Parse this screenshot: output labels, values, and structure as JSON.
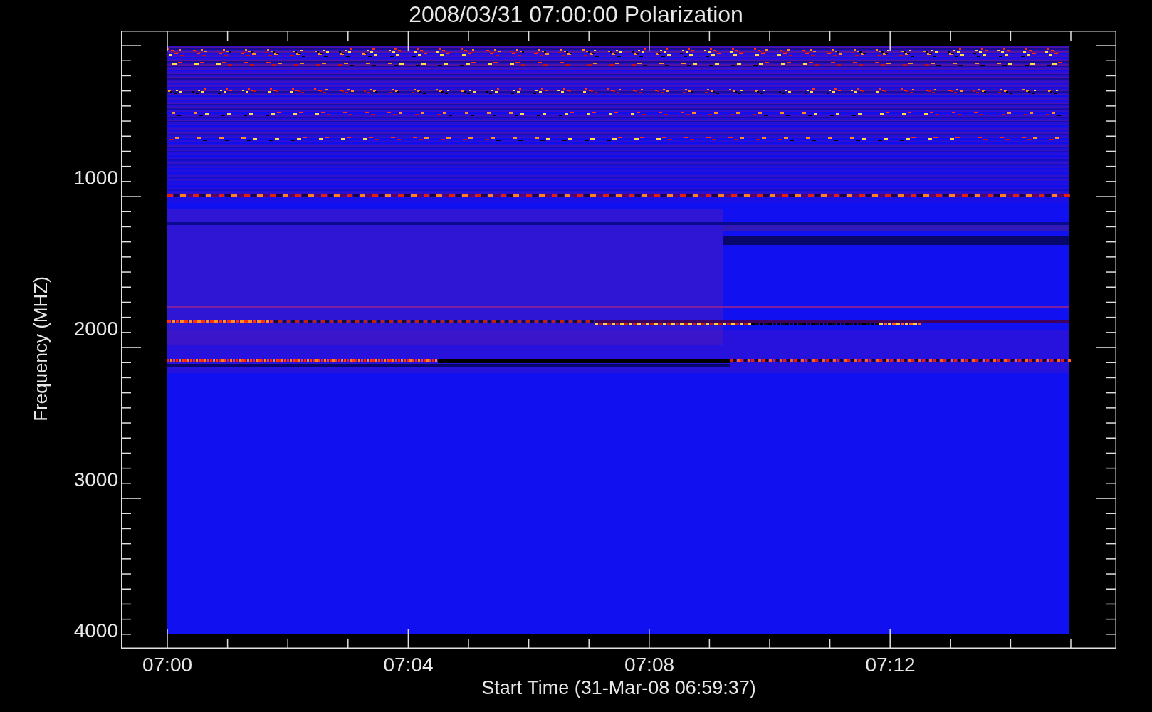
{
  "title": "2008/03/31 07:00:00 Polarization",
  "y_axis": {
    "label": "Frequency (MHZ)",
    "ticks": [
      "1000",
      "2000",
      "3000",
      "4000"
    ]
  },
  "x_axis": {
    "label": "Start Time (31-Mar-08 06:59:37)",
    "ticks": [
      "07:00",
      "07:04",
      "07:08",
      "07:12"
    ]
  }
}
